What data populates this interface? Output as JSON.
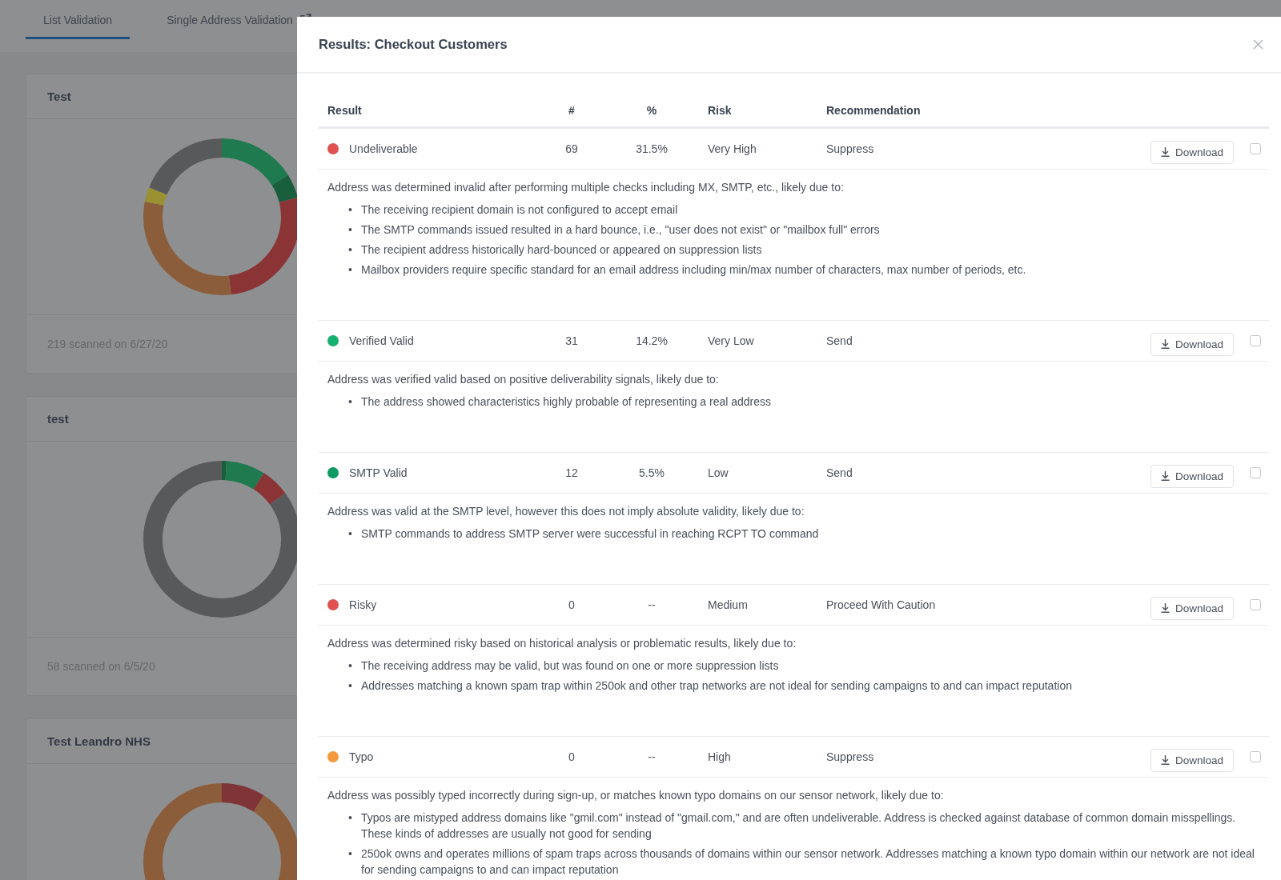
{
  "tabs": [
    {
      "label": "List Validation",
      "selected": true,
      "external": false
    },
    {
      "label": "Single Address Validation",
      "selected": false,
      "external": true
    }
  ],
  "lists": [
    {
      "name": "Test",
      "footer": "219 scanned on 6/27/20"
    },
    {
      "name": "test",
      "footer": "58 scanned on 6/5/20"
    },
    {
      "name": "Test Leandro NHS"
    }
  ],
  "modal": {
    "title": "Results: Checkout Customers",
    "bullet": "•",
    "columns": [
      "Result",
      "#",
      "%",
      "Risk",
      "Recommendation"
    ],
    "rows": [
      {
        "result": "Undeliverable",
        "color": "#e05252",
        "count": "69",
        "percent": "31.5%",
        "risk": "Very High",
        "recommendation": "Suppress",
        "button": "Download",
        "checked": false,
        "description": "Address was determined invalid after performing multiple checks including MX, SMTP, etc., likely due to:",
        "reasons": [
          "The receiving recipient domain is not configured to accept email",
          "The SMTP commands issued resulted in a hard bounce, i.e., \"user does not exist\" or \"mailbox full\" errors",
          "The recipient address historically hard-bounced or appeared on suppression lists",
          "Mailbox providers require specific standard for an email address including min/max number of characters, max number of periods, etc."
        ]
      },
      {
        "result": "Verified Valid",
        "color": "#15b06f",
        "count": "31",
        "percent": "14.2%",
        "risk": "Very Low",
        "recommendation": "Send",
        "button": "Download",
        "checked": false,
        "description": "Address was verified valid based on positive deliverability signals, likely due to:",
        "reasons": [
          "The address showed characteristics highly probable of representing a real address"
        ]
      },
      {
        "result": "SMTP Valid",
        "color": "#0f9a62",
        "count": "12",
        "percent": "5.5%",
        "risk": "Low",
        "recommendation": "Send",
        "button": "Download",
        "checked": false,
        "description": "Address was valid at the SMTP level, however this does not imply absolute validity, likely due to:",
        "reasons": [
          "SMTP commands to address SMTP server were successful in reaching RCPT TO command"
        ]
      },
      {
        "result": "Risky",
        "color": "#e05252",
        "count": "0",
        "percent": "--",
        "risk": "Medium",
        "recommendation": "Proceed With Caution",
        "button": "Download",
        "checked": false,
        "description": "Address was determined risky based on historical analysis or problematic results, likely due to:",
        "reasons": [
          "The receiving address may be valid, but was found on one or more suppression lists",
          "Addresses matching a known spam trap within 250ok and other trap networks are not ideal for sending campaigns to and can impact reputation"
        ]
      },
      {
        "result": "Typo",
        "color": "#f59a3a",
        "count": "0",
        "percent": "--",
        "risk": "High",
        "recommendation": "Suppress",
        "button": "Download",
        "checked": false,
        "description": "Address was possibly typed incorrectly during sign-up, or matches known typo domains on our sensor network, likely due to:",
        "reasons": [
          "Typos are mistyped address domains like \"gmil.com\" instead of \"gmail.com,\" and are often undeliverable. Address is checked against database of common domain misspellings. These kinds of addresses are usually not good for sending",
          "250ok owns and operates millions of spam traps across thousands of domains within our sensor network. Addresses matching a known typo domain within our network are not ideal for sending campaigns to and can impact reputation"
        ]
      }
    ]
  }
}
